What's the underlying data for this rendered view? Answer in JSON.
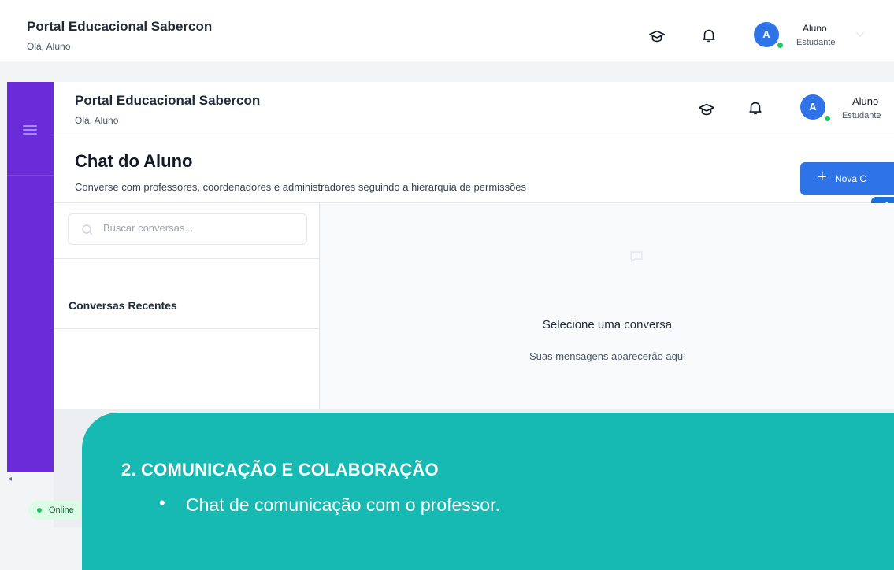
{
  "app": {
    "title": "Portal Educacional Sabercon",
    "greeting": "Olá, Aluno"
  },
  "user": {
    "initial": "A",
    "name": "Aluno",
    "role": "Estudante",
    "status_color": "#22c55e"
  },
  "icons": {
    "courses": "graduation-cap-icon",
    "notifications": "bell-icon",
    "menu": "hamburger-menu-icon",
    "search": "search-icon",
    "chat_placeholder": "chat-bubble-icon",
    "accessibility": "accessibility-person-icon",
    "sign_language": "sign-language-hands-icon"
  },
  "colors": {
    "sidebar": "#6a2bd9",
    "primary": "#2f73e9",
    "overlay": "#16bab3",
    "online": "#22c55e"
  },
  "page": {
    "title": "Chat do Aluno",
    "description": "Converse com professores, coordenadores e administradores seguindo a hierarquia de permissões",
    "new_button": "Nova C",
    "new_button_plus": "+"
  },
  "chat": {
    "search_placeholder": "Buscar conversas...",
    "recent_heading": "Conversas Recentes",
    "empty_title": "Selecione uma conversa",
    "empty_subtitle": "Suas mensagens aparecerão aqui"
  },
  "status": {
    "online_label": "Online",
    "collapse_arrow": "◂"
  },
  "overlay": {
    "heading": "2.  COMUNICAÇÃO E COLABORAÇÃO",
    "bullet": "•",
    "item": "Chat de comunicação com o professor."
  }
}
